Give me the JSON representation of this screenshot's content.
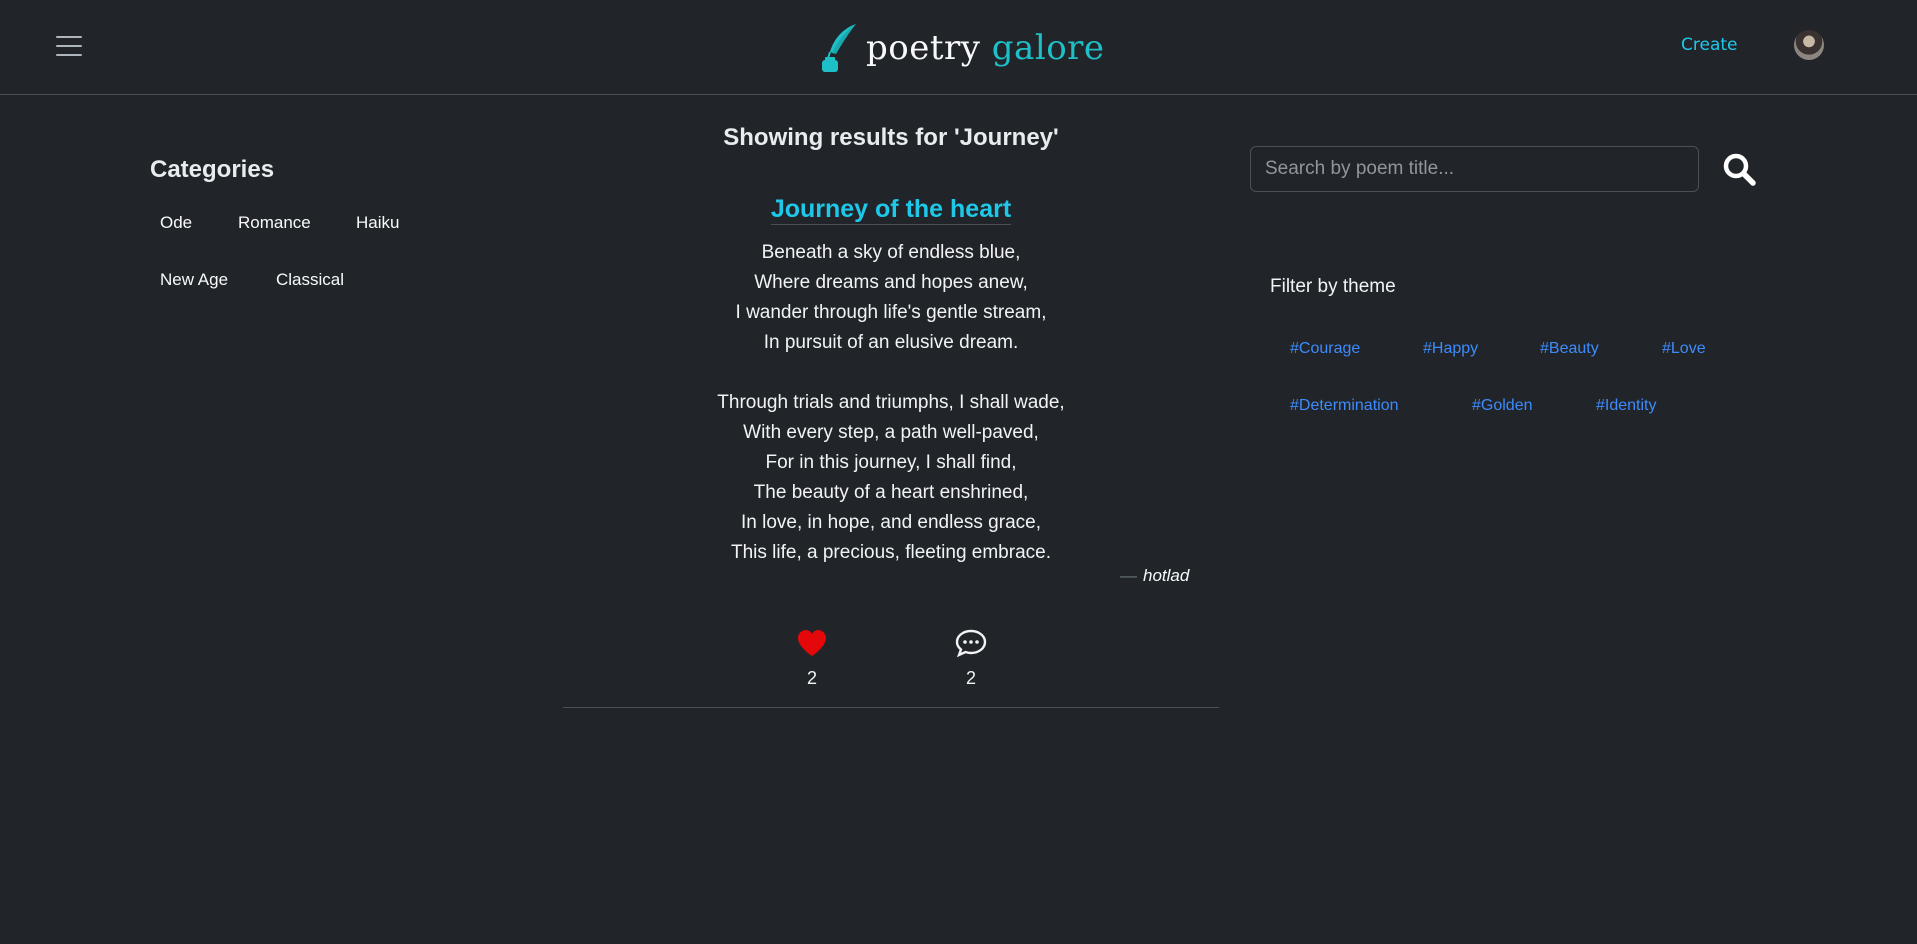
{
  "navbar": {
    "brand_word1": "poetry",
    "brand_word2": "galore",
    "create_label": "Create",
    "brand_accent": "#1ec0c7"
  },
  "sidebar": {
    "title": "Categories",
    "categories": [
      "Ode",
      "Romance",
      "Haiku",
      "New Age",
      "Classical"
    ]
  },
  "main": {
    "results_heading": "Showing results for 'Journey'",
    "poem": {
      "title": "Journey of the heart",
      "stanza1": [
        "Beneath a sky of endless blue,",
        "Where dreams and hopes anew,",
        "I wander through life's gentle stream,",
        "In pursuit of an elusive dream."
      ],
      "stanza2": [
        "Through trials and triumphs, I shall wade,",
        "With every step, a path well-paved,",
        "For in this journey, I shall find,",
        "The beauty of a heart enshrined,",
        "In love, in hope, and endless grace,",
        "This life, a precious, fleeting embrace."
      ],
      "author_dash": "—",
      "author": "hotlad",
      "likes": "2",
      "comments": "2"
    }
  },
  "right": {
    "search_placeholder": "Search by poem title...",
    "filter_title": "Filter by theme",
    "themes": [
      "#Courage",
      "#Happy",
      "#Beauty",
      "#Love",
      "#Determination",
      "#Golden",
      "#Identity"
    ]
  },
  "icons": {
    "menu": "hamburger-icon",
    "brand": "quill-inkwell-icon",
    "search": "search-icon",
    "like": "heart-icon",
    "comment": "comment-icon"
  },
  "colors": {
    "background": "#212529",
    "link_accent": "#1ec8e8",
    "tag_color": "#3d8bfd",
    "heart": "#e4080a"
  }
}
